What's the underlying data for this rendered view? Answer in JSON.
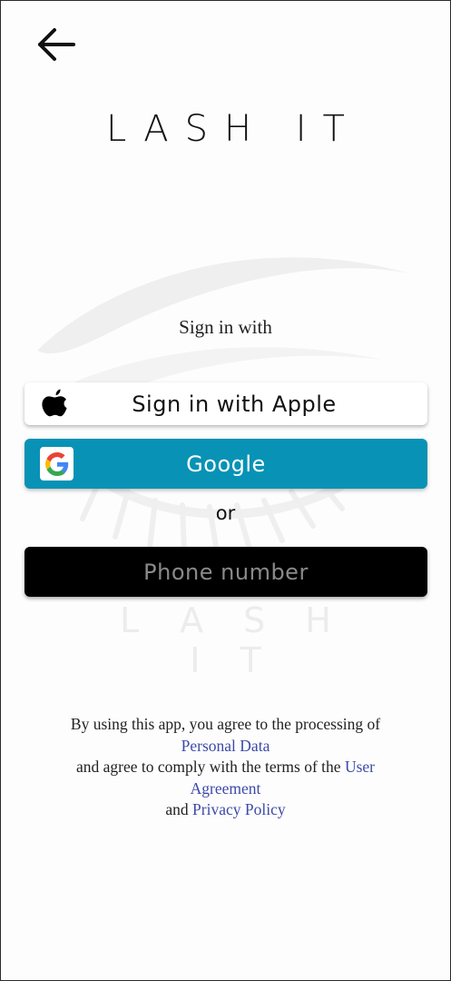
{
  "header": {
    "back_icon": "arrow-left-icon",
    "brand_title": "LASH IT"
  },
  "background": {
    "watermark_text": "LASH IT",
    "watermark_icon": "eyelash-logo-icon"
  },
  "signin": {
    "label": "Sign in with",
    "apple_button": {
      "label": "Sign in with Apple",
      "icon": "apple-icon"
    },
    "google_button": {
      "label": "Google",
      "icon": "google-icon",
      "color": "#0892b5"
    },
    "separator": "or",
    "phone_button": {
      "placeholder": "Phone number"
    }
  },
  "legal": {
    "line1": "By using this app, you agree to the processing of",
    "personal_data_link": "Personal Data",
    "line2": "and agree to comply with the terms of the",
    "user_agreement_link": "User Agreement",
    "line3": "and",
    "privacy_policy_link": "Privacy Policy",
    "link_color": "#3d4aa8"
  }
}
